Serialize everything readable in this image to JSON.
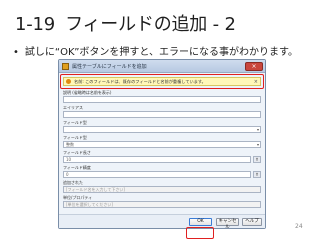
{
  "slide": {
    "number": "1-19",
    "title": "フィールドの追加 - 2",
    "bullet": "•",
    "instruction": "試しに“OK”ボタンを押すと、エラーになる事がわかります。",
    "page_number": "24"
  },
  "dialog": {
    "title": "属性テーブルにフィールドを追加",
    "close": "×",
    "warning": "名前: このフィールドは、既存のフィールドと名前が重複しています。",
    "warning_close": "×",
    "fields": [
      {
        "label": "説明 (省略時は名前を表示)",
        "value": ""
      },
      {
        "label": "エイリアス",
        "value": ""
      },
      {
        "label": "フィールド型",
        "value": ""
      },
      {
        "label": "フィールド型",
        "value": "整数"
      },
      {
        "label": "フィールド長さ",
        "value": "10"
      },
      {
        "label": "フィールド精度",
        "value": "0"
      },
      {
        "label": "追加された",
        "value": "[フィールド名を入力して下さい]"
      },
      {
        "label": "単位/プロパティ",
        "value": "[単位を選択してください]"
      }
    ],
    "buttons": {
      "ok": "OK",
      "cancel": "キャンセル",
      "help": "ヘルプ"
    }
  }
}
